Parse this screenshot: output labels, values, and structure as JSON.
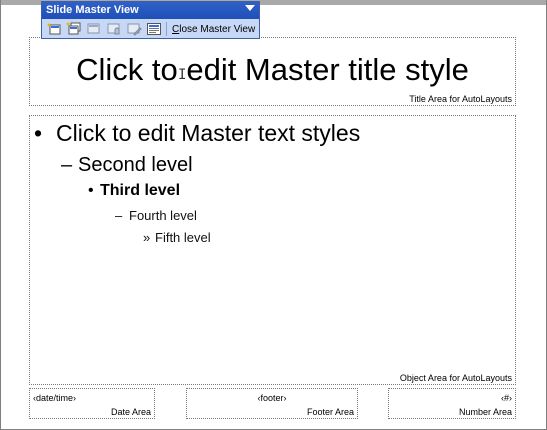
{
  "toolbar": {
    "title": "Slide Master View",
    "buttons": [
      {
        "icon": "insert-new-slide-master-icon"
      },
      {
        "icon": "insert-new-title-master-icon"
      },
      {
        "icon": "delete-master-icon"
      },
      {
        "icon": "preserve-master-icon"
      },
      {
        "icon": "rename-master-icon"
      },
      {
        "icon": "master-layout-icon"
      }
    ],
    "close_prefix": "C",
    "close_rest": "lose Master View"
  },
  "slide": {
    "title_placeholder": "Click to edit Master title style",
    "title_area_label": "Title Area for AutoLayouts",
    "levels": [
      {
        "bullet": "•",
        "text": "Click to edit Master text styles"
      },
      {
        "bullet": "–",
        "text": "Second level"
      },
      {
        "bullet": "•",
        "text": "Third level"
      },
      {
        "bullet": "–",
        "text": "Fourth level"
      },
      {
        "bullet": "»",
        "text": "Fifth level"
      }
    ],
    "object_area_label": "Object Area for AutoLayouts",
    "date_tag": "‹date/time›",
    "date_label": "Date Area",
    "footer_tag": "‹footer›",
    "footer_label": "Footer Area",
    "number_tag": "‹#›",
    "number_label": "Number Area"
  },
  "colors": {
    "toolbar_bar": "#2e61c9",
    "toolbar_body": "#c7d8f7"
  }
}
